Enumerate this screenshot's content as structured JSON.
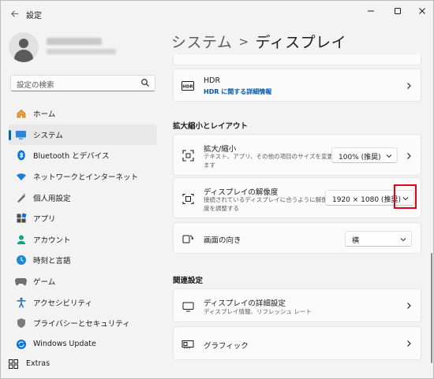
{
  "window": {
    "title": "設定",
    "back_icon": "arrow-left-icon",
    "controls": [
      "minimize-icon",
      "maximize-icon",
      "close-icon"
    ]
  },
  "search": {
    "placeholder": "設定の検索"
  },
  "sidebar": {
    "items": [
      {
        "label": "ホーム",
        "icon": "home-icon"
      },
      {
        "label": "システム",
        "icon": "system-icon",
        "selected": true
      },
      {
        "label": "Bluetooth とデバイス",
        "icon": "bluetooth-icon"
      },
      {
        "label": "ネットワークとインターネット",
        "icon": "wifi-icon"
      },
      {
        "label": "個人用設定",
        "icon": "personalization-icon"
      },
      {
        "label": "アプリ",
        "icon": "apps-icon"
      },
      {
        "label": "アカウント",
        "icon": "account-icon"
      },
      {
        "label": "時刻と言語",
        "icon": "time-language-icon"
      },
      {
        "label": "ゲーム",
        "icon": "game-icon"
      },
      {
        "label": "アクセシビリティ",
        "icon": "accessibility-icon"
      },
      {
        "label": "プライバシーとセキュリティ",
        "icon": "privacy-shield-icon"
      },
      {
        "label": "Windows Update",
        "icon": "windows-update-icon"
      }
    ],
    "extras_label": "Extras"
  },
  "breadcrumb": {
    "parent": "システム",
    "separator": ">",
    "current": "ディスプレイ"
  },
  "hdr": {
    "title": "HDR",
    "link": "HDR に関する詳細情報"
  },
  "scale_layout": {
    "header": "拡大縮小とレイアウト",
    "scale": {
      "title": "拡大/縮小",
      "subtitle_line1": "テキスト、アプリ、その他の項目のサイズを変更し",
      "subtitle_line2": "ます",
      "value": "100% (推奨)"
    },
    "resolution": {
      "title": "ディスプレイの解像度",
      "subtitle_line1": "接続されているディスプレイに合うように解像",
      "subtitle_line2": "度を調整する",
      "value": "1920 × 1080 (推奨)"
    },
    "orientation": {
      "title": "画面の向き",
      "value": "横"
    }
  },
  "related": {
    "header": "関連設定",
    "advanced": {
      "title": "ディスプレイの詳細設定",
      "subtitle": "ディスプレイ情報、リフレッシュ レート"
    },
    "graphics": {
      "title": "グラフィック"
    }
  },
  "colors": {
    "accent": "#0067c0",
    "highlight": "#e2001a"
  }
}
